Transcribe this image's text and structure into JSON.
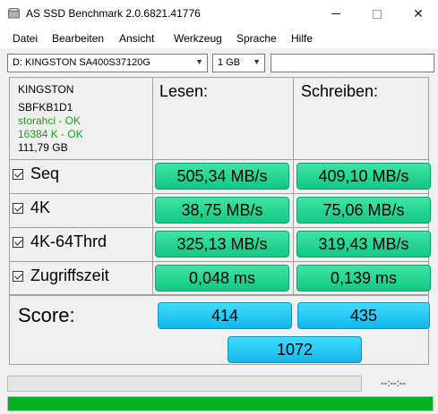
{
  "window": {
    "title": "AS SSD Benchmark 2.0.6821.41776"
  },
  "menu": [
    {
      "label": "Datei"
    },
    {
      "label": "Bearbeiten"
    },
    {
      "label": "Ansicht"
    },
    {
      "label": "Werkzeug"
    },
    {
      "label": "Sprache"
    },
    {
      "label": "Hilfe"
    }
  ],
  "toolbar": {
    "drive": "D: KINGSTON SA400S37120G",
    "size": "1 GB",
    "input_value": ""
  },
  "drive_info": {
    "name": "KINGSTON",
    "firmware": "SBFKB1D1",
    "driver_status": "storahci - OK",
    "alignment_status": "16384 K - OK",
    "capacity": "111,79 GB"
  },
  "columns": {
    "read": "Lesen:",
    "write": "Schreiben:"
  },
  "tests": [
    {
      "label": "Seq",
      "read": "505,34 MB/s",
      "write": "409,10 MB/s",
      "checked": true
    },
    {
      "label": "4K",
      "read": "38,75 MB/s",
      "write": "75,06 MB/s",
      "checked": true
    },
    {
      "label": "4K-64Thrd",
      "read": "325,13 MB/s",
      "write": "319,43 MB/s",
      "checked": true
    },
    {
      "label": "Zugriffszeit",
      "read": "0,048 ms",
      "write": "0,139 ms",
      "checked": true
    }
  ],
  "score": {
    "label": "Score:",
    "read": "414",
    "write": "435",
    "total": "1072"
  },
  "status": {
    "elapsed": "--:--:--",
    "top_progress": 0,
    "bottom_progress": 1.0
  },
  "colors": {
    "result_green": "#19cf8c",
    "score_blue": "#1cc0f0",
    "progress_green": "#06b025"
  },
  "icons": [
    "app-icon",
    "minimize-icon",
    "maximize-icon",
    "close-icon",
    "dropdown-arrow-icon",
    "checkbox-checked-icon"
  ]
}
